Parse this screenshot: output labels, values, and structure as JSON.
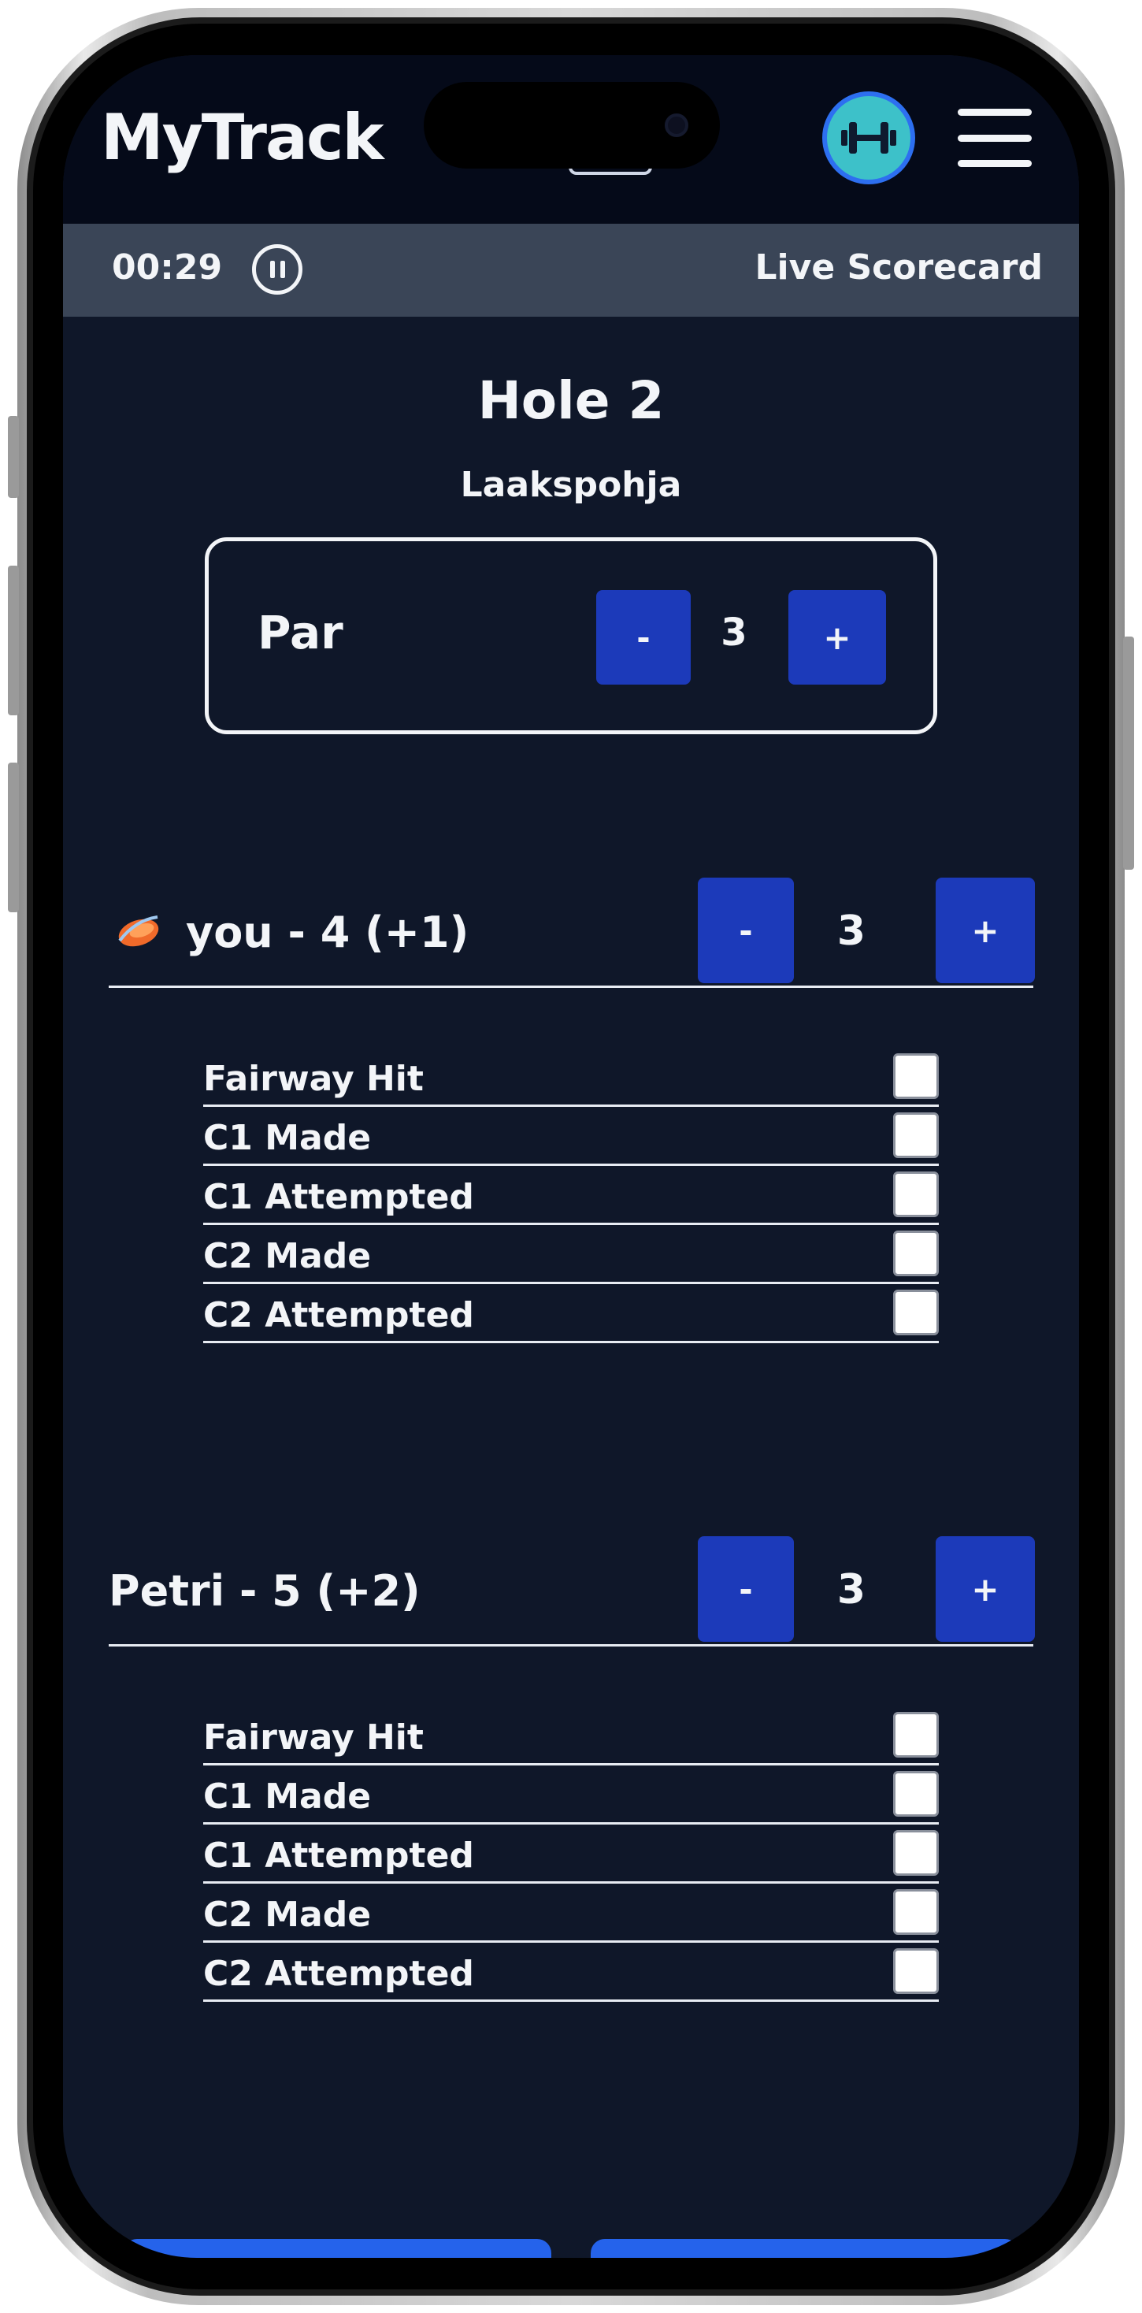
{
  "app": {
    "title": "MyTrack"
  },
  "timer": {
    "elapsed": "00:29",
    "label": "Live Scorecard"
  },
  "hole": {
    "title": "Hole 2",
    "course": "Laakspohja",
    "par_label": "Par",
    "par_value": "3",
    "decrement_label": "-",
    "increment_label": "+"
  },
  "players": [
    {
      "name": "you - 4 (+1)",
      "throws": "3",
      "decrement_label": "-",
      "increment_label": "+",
      "stats": [
        {
          "label": "Fairway Hit",
          "checked": false
        },
        {
          "label": "C1 Made",
          "checked": false
        },
        {
          "label": "C1 Attempted",
          "checked": false
        },
        {
          "label": "C2 Made",
          "checked": false
        },
        {
          "label": "C2 Attempted",
          "checked": false
        }
      ]
    },
    {
      "name": "Petri - 5 (+2)",
      "throws": "3",
      "decrement_label": "-",
      "increment_label": "+",
      "stats": [
        {
          "label": "Fairway Hit",
          "checked": false
        },
        {
          "label": "C1 Made",
          "checked": false
        },
        {
          "label": "C1 Attempted",
          "checked": false
        },
        {
          "label": "C2 Made",
          "checked": false
        },
        {
          "label": "C2 Attempted",
          "checked": false
        }
      ]
    }
  ],
  "icons": {
    "avatar": "dumbbell-icon",
    "menu": "hamburger-menu-icon",
    "pause": "pause-icon",
    "disc": "disc-golf-icon"
  },
  "colors": {
    "background": "#0f1729",
    "header": "#050a19",
    "timer_bar": "#3a4557",
    "button": "#1c3aba",
    "avatar": "#3dc1c9",
    "accent": "#2563eb"
  }
}
